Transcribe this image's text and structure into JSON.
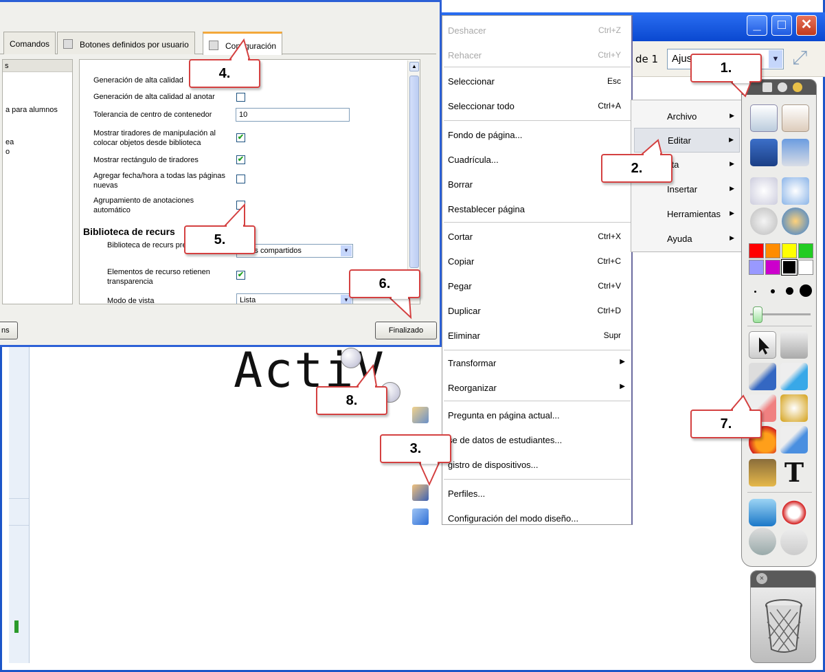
{
  "window": {
    "min_glyph": "_",
    "max_glyph": "□",
    "close_glyph": "✕",
    "page_counter": "de 1",
    "zoom_value": "Ajus",
    "fullscreen_glyph": "⤢"
  },
  "dialog": {
    "tabs": [
      {
        "label": "Comandos"
      },
      {
        "label": "Botones definidos por usuario"
      },
      {
        "label": "Configuración"
      }
    ],
    "left_pane": {
      "header": "s",
      "items": [
        "a para alumnos",
        "ea",
        "o"
      ]
    },
    "settings": {
      "high_quality_generation": "Generación de alta calidad",
      "high_quality_annotate": "Generación de alta calidad al anotar",
      "container_tolerance": "Tolerancia de centro de contenedor",
      "container_tolerance_value": "10",
      "show_handles_library": "Mostrar tiradores de manipulación al colocar objetos desde biblioteca",
      "show_handles_rect": "Mostrar rectángulo de tiradores",
      "add_datetime": "Agregar fecha/hora a todas las páginas nuevas",
      "auto_group": "Agrupamiento de anotaciones automático",
      "section_heading": "Biblioteca de recurs",
      "default_library": "Biblioteca de recurs predeterminada",
      "default_library_value": "ursos compartidos",
      "keep_transparency": "Elementos de recurso retienen transparencia",
      "view_mode": "Modo de vista",
      "view_mode_value": "Lista"
    },
    "checked_glyph": "✔",
    "done_label": "Finalizado",
    "left_button_label": "ns"
  },
  "edit_menu": {
    "items": [
      {
        "label": "Deshacer",
        "shortcut": "Ctrl+Z",
        "disabled": true
      },
      {
        "label": "Rehacer",
        "shortcut": "Ctrl+Y",
        "disabled": true
      },
      {
        "label": "Seleccionar",
        "shortcut": "Esc"
      },
      {
        "label": "Seleccionar todo",
        "shortcut": "Ctrl+A"
      },
      {
        "label": "Fondo de página..."
      },
      {
        "label": "Cuadrícula..."
      },
      {
        "label": "Borrar"
      },
      {
        "label": "Restablecer página"
      },
      {
        "label": "Cortar",
        "shortcut": "Ctrl+X"
      },
      {
        "label": "Copiar",
        "shortcut": "Ctrl+C"
      },
      {
        "label": "Pegar",
        "shortcut": "Ctrl+V"
      },
      {
        "label": "Duplicar",
        "shortcut": "Ctrl+D"
      },
      {
        "label": "Eliminar",
        "shortcut": "Supr"
      },
      {
        "label": "Transformar",
        "submenu": "▶"
      },
      {
        "label": "Reorganizar",
        "submenu": "▶"
      },
      {
        "label": "Pregunta en página actual..."
      },
      {
        "label": "se de datos de estudiantes..."
      },
      {
        "label": "gistro de dispositivos..."
      },
      {
        "label": "Perfiles..."
      },
      {
        "label": "Configuración del modo diseño..."
      }
    ]
  },
  "main_menu": {
    "items": [
      {
        "label": "Archivo"
      },
      {
        "label": "Editar"
      },
      {
        "label": "sta"
      },
      {
        "label": "Insertar"
      },
      {
        "label": "Herramientas"
      },
      {
        "label": "Ayuda"
      }
    ],
    "arrow_glyph": "▶"
  },
  "canvas": {
    "handwriting": "ActiV"
  },
  "palette": {
    "colors": [
      "#ff0000",
      "#ff8c00",
      "#ffff00",
      "#22cc22",
      "#9999ff",
      "#cc00cc",
      "#000000",
      "#ffffff"
    ],
    "text_tool_glyph": "T",
    "trash_close_glyph": "×"
  },
  "callouts": [
    "1.",
    "2.",
    "3.",
    "4.",
    "5.",
    "6.",
    "7.",
    "8."
  ]
}
